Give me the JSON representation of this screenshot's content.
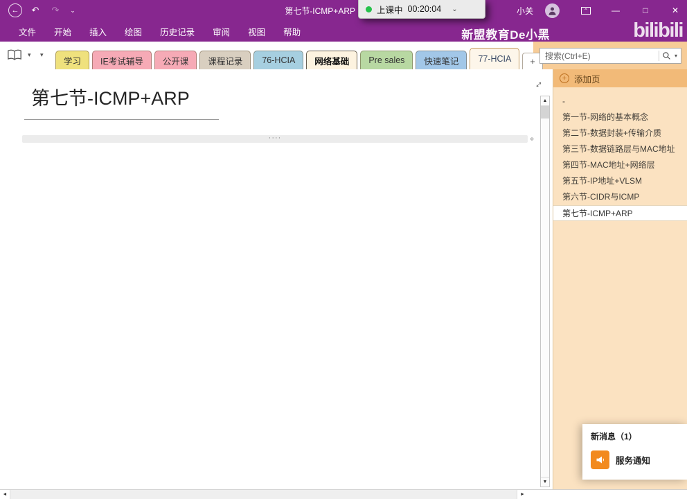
{
  "titlebar": {
    "title": "第七节-ICMP+ARP",
    "user": "小关",
    "timer": {
      "status": "上课中",
      "time": "00:20:04"
    }
  },
  "menubar": {
    "items": [
      "文件",
      "开始",
      "插入",
      "绘图",
      "历史记录",
      "审阅",
      "视图",
      "帮助"
    ],
    "watermark": "新盟教育De小黑",
    "watermark_logo": "bilibili"
  },
  "tabstrip": {
    "tabs": [
      {
        "label": "学习",
        "color": "#efe17d"
      },
      {
        "label": "IE考试辅导",
        "color": "#f6aab6"
      },
      {
        "label": "公开课",
        "color": "#f6aab6"
      },
      {
        "label": "课程记录",
        "color": "#d9cfc0"
      },
      {
        "label": "76-HCIA",
        "color": "#a6cfe0"
      },
      {
        "label": "网络基础",
        "color": "#fdf3e0"
      },
      {
        "label": "Pre sales",
        "color": "#b8d8a2"
      },
      {
        "label": "快速笔记",
        "color": "#a2c7e8"
      },
      {
        "label": "77-HCIA",
        "color": "#fdf6ea"
      }
    ],
    "add_tab": "+",
    "search_placeholder": "搜索(Ctrl+E)"
  },
  "page": {
    "title": "第七节-ICMP+ARP"
  },
  "sidebar": {
    "add_page": "添加页",
    "pages": [
      "-",
      "第一节-网络的基本概念",
      "第二节-数据封装+传输介质",
      "第三节-数据链路层与MAC地址",
      "第四节-MAC地址+网络层",
      "第五节-IP地址+VLSM",
      "第六节-CIDR与ICMP",
      "第七节-ICMP+ARP"
    ],
    "selected_index": 7
  },
  "notification": {
    "title": "新消息（1）",
    "item": "服务通知"
  },
  "icons": {
    "back": "←",
    "undo": "↶",
    "redo": "↷",
    "customize": "⌄",
    "ribbon_options": "⌃",
    "minimize": "—",
    "maximize": "□",
    "close": "✕",
    "timer_chevron": "⌄",
    "notebook_dropdown": "▾",
    "search_caret": "▾",
    "scroll_up": "▲",
    "scroll_down": "▼",
    "scroll_left": "◄",
    "scroll_right": "►",
    "expand": "↔",
    "outline_dots": "····",
    "outline_handle": "‹›",
    "add_page_plus": "+"
  },
  "colors": {
    "brand_purple": "#87278f",
    "tabstrip_orange": "#f7cc97",
    "sidebar_orange": "#fbe2c1",
    "sidebar_header_orange": "#f2ba78",
    "timer_green": "#27c24c",
    "notification_orange": "#f28a1e",
    "selected_page_bg": "#ffffff"
  }
}
